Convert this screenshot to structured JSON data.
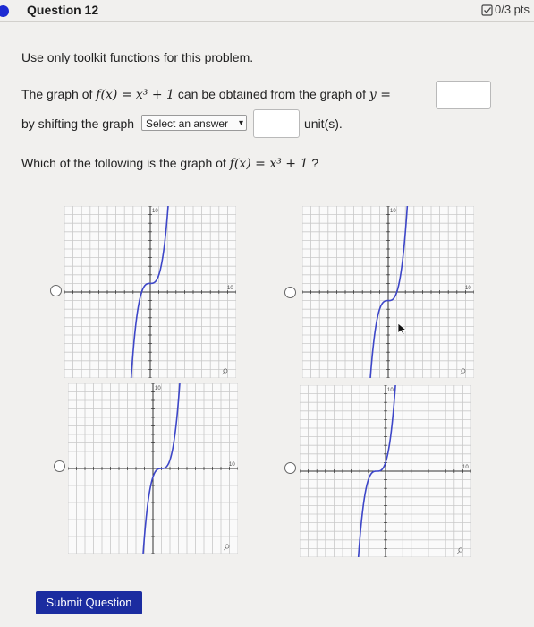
{
  "header": {
    "question_title": "Question 12",
    "points": "0/3 pts"
  },
  "body": {
    "instruction": "Use only toolkit functions for this problem.",
    "line1_prefix": "The graph of",
    "line1_func": "f(x) = x³ + 1",
    "line1_mid": "can be obtained from the graph of",
    "line1_y": "y =",
    "line2_prefix": "by shifting the graph",
    "select_value": "Select an answer",
    "line2_suffix": "unit(s).",
    "question2_prefix": "Which of the following is the graph of",
    "question2_func": "f(x) = x³ + 1",
    "question2_suffix": "?"
  },
  "graph_options": [
    {
      "tick_label": "10",
      "zoom_glyph": "⌕"
    },
    {
      "tick_label": "10",
      "zoom_glyph": "⌕"
    },
    {
      "tick_label": "10",
      "zoom_glyph": "⌕"
    },
    {
      "tick_label": "10",
      "zoom_glyph": "⌕"
    }
  ],
  "submit_label": "Submit Question",
  "colors": {
    "curve": "#3d46c8",
    "accent": "#1b2ca0",
    "dot": "#1d2bd2"
  }
}
